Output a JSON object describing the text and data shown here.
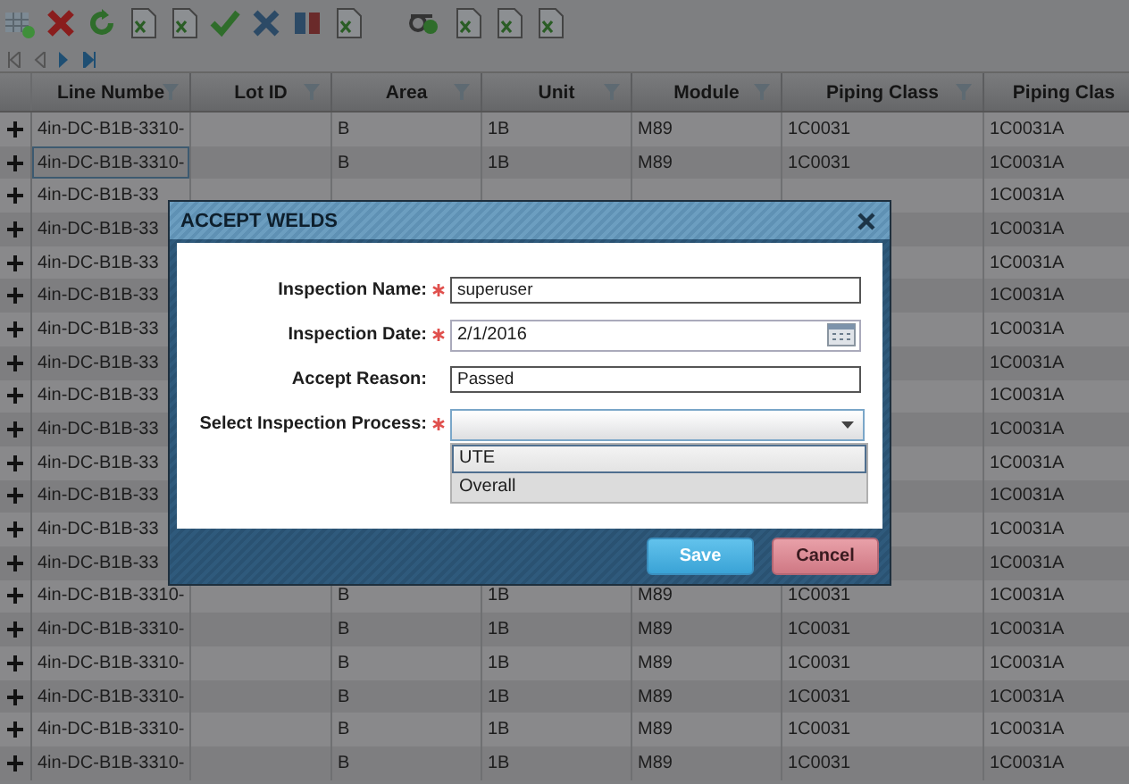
{
  "table": {
    "columns": [
      {
        "label": "Line Numbe",
        "filter": true
      },
      {
        "label": "Lot ID",
        "filter": true
      },
      {
        "label": "Area",
        "filter": true
      },
      {
        "label": "Unit",
        "filter": true
      },
      {
        "label": "Module",
        "filter": true
      },
      {
        "label": "Piping Class",
        "filter": true
      },
      {
        "label": "Piping Clas",
        "filter": false
      }
    ],
    "rows": [
      {
        "selected": false,
        "cells": [
          "4in-DC-B1B-3310-",
          null,
          "B",
          "1B",
          "M89",
          "1C0031",
          "1C0031A"
        ]
      },
      {
        "selected": true,
        "cells": [
          "4in-DC-B1B-3310-",
          null,
          "B",
          "1B",
          "M89",
          "1C0031",
          "1C0031A"
        ]
      },
      {
        "selected": false,
        "cells": [
          "4in-DC-B1B-33",
          "1C0031A"
        ]
      },
      {
        "selected": false,
        "cells": [
          "4in-DC-B1B-33",
          "1C0031A"
        ]
      },
      {
        "selected": false,
        "cells": [
          "4in-DC-B1B-33",
          "1C0031A"
        ]
      },
      {
        "selected": false,
        "cells": [
          "4in-DC-B1B-33",
          "1C0031A"
        ]
      },
      {
        "selected": false,
        "cells": [
          "4in-DC-B1B-33",
          "1C0031A"
        ]
      },
      {
        "selected": false,
        "cells": [
          "4in-DC-B1B-33",
          "1C0031A"
        ]
      },
      {
        "selected": false,
        "cells": [
          "4in-DC-B1B-33",
          "1C0031A"
        ]
      },
      {
        "selected": false,
        "cells": [
          "4in-DC-B1B-33",
          "1C0031A"
        ]
      },
      {
        "selected": false,
        "cells": [
          "4in-DC-B1B-33",
          "1C0031A"
        ]
      },
      {
        "selected": false,
        "cells": [
          "4in-DC-B1B-33",
          "1C0031A"
        ]
      },
      {
        "selected": false,
        "cells": [
          "4in-DC-B1B-33",
          "1C0031A"
        ]
      },
      {
        "selected": false,
        "cells": [
          "4in-DC-B1B-33",
          "1C0031A"
        ]
      },
      {
        "selected": false,
        "cells": [
          "4in-DC-B1B-3310-",
          null,
          "B",
          "1B",
          "M89",
          "1C0031",
          "1C0031A"
        ]
      },
      {
        "selected": false,
        "cells": [
          "4in-DC-B1B-3310-",
          null,
          "B",
          "1B",
          "M89",
          "1C0031",
          "1C0031A"
        ]
      },
      {
        "selected": false,
        "cells": [
          "4in-DC-B1B-3310-",
          null,
          "B",
          "1B",
          "M89",
          "1C0031",
          "1C0031A"
        ]
      },
      {
        "selected": false,
        "cells": [
          "4in-DC-B1B-3310-",
          null,
          "B",
          "1B",
          "M89",
          "1C0031",
          "1C0031A"
        ]
      },
      {
        "selected": false,
        "cells": [
          "4in-DC-B1B-3310-",
          null,
          "B",
          "1B",
          "M89",
          "1C0031",
          "1C0031A"
        ]
      },
      {
        "selected": false,
        "cells": [
          "4in-DC-B1B-3310-",
          null,
          "B",
          "1B",
          "M89",
          "1C0031",
          "1C0031A"
        ]
      }
    ]
  },
  "dialog": {
    "title": "ACCEPT WELDS",
    "fields": [
      {
        "kind": "text",
        "label": "Inspection Name:",
        "required": true,
        "value": "superuser"
      },
      {
        "kind": "date",
        "label": "Inspection Date:",
        "required": true,
        "value": "2/1/2016"
      },
      {
        "kind": "text",
        "label": "Accept Reason:",
        "required": false,
        "value": "Passed"
      },
      {
        "kind": "select",
        "label": "Select Inspection Process:",
        "required": true,
        "expanded": true,
        "options": [
          {
            "label": "UTE",
            "selected": true
          },
          {
            "label": "Overall",
            "selected": false
          }
        ]
      }
    ],
    "buttons": [
      {
        "kind": "primary",
        "label": "Save"
      },
      {
        "kind": "danger",
        "label": "Cancel"
      }
    ]
  }
}
